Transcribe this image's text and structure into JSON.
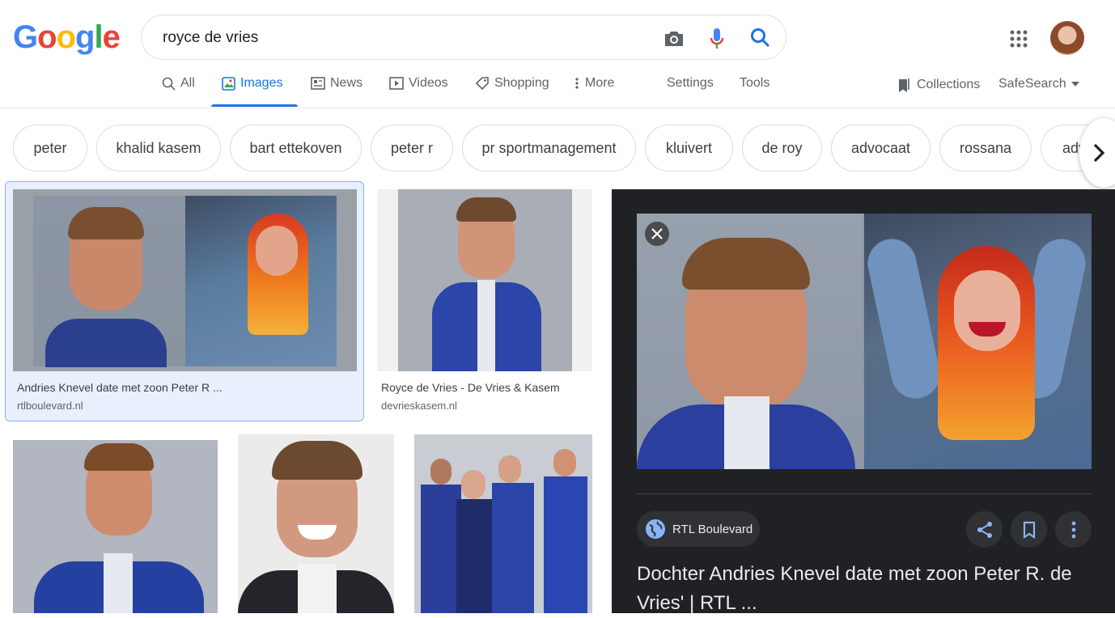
{
  "logo": {
    "letters": [
      "G",
      "o",
      "o",
      "g",
      "l",
      "e"
    ]
  },
  "search": {
    "query": "royce de vries"
  },
  "icons": {
    "camera": "camera-icon",
    "mic": "mic-icon",
    "search": "search-icon",
    "apps": "apps-icon",
    "avatar": "avatar"
  },
  "tabs": [
    {
      "label": "All"
    },
    {
      "label": "Images"
    },
    {
      "label": "News"
    },
    {
      "label": "Videos"
    },
    {
      "label": "Shopping"
    },
    {
      "label": "More"
    },
    {
      "label": "Settings"
    },
    {
      "label": "Tools"
    }
  ],
  "right_links": {
    "collections": "Collections",
    "safesearch": "SafeSearch"
  },
  "chips": [
    "peter",
    "khalid kasem",
    "bart ettekoven",
    "peter r",
    "pr sportmanagement",
    "kluivert",
    "de roy",
    "advocaat",
    "rossana",
    "adv"
  ],
  "results": [
    {
      "title": "Andries Knevel date met zoon Peter R ...",
      "source": "rtlboulevard.nl"
    },
    {
      "title": "Royce de Vries - De Vries & Kasem",
      "source": "devrieskasem.nl"
    }
  ],
  "preview": {
    "source_name": "RTL Boulevard",
    "title": "Dochter Andries Knevel date met zoon Peter R. de Vries' | RTL ..."
  },
  "colors": {
    "blue": "#4285F4",
    "red": "#EA4335",
    "yellow": "#FBBC05",
    "green": "#34A853",
    "link": "#1a73e8",
    "panel": "#202124"
  }
}
